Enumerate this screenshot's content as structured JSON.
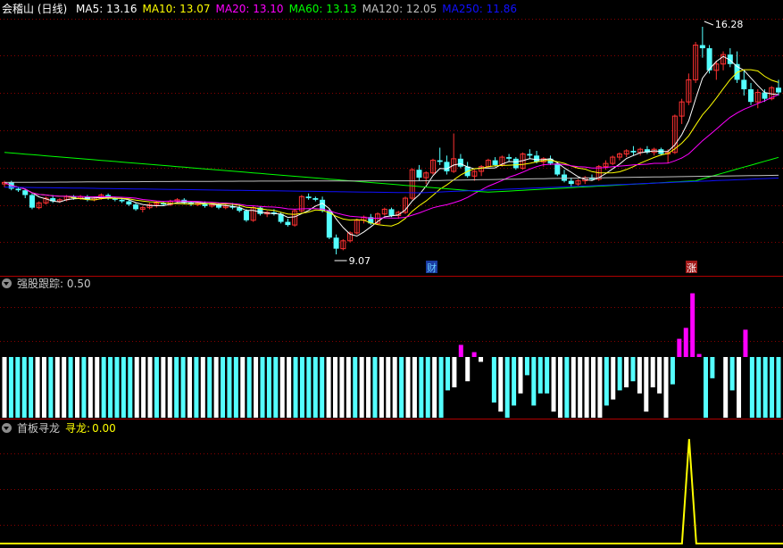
{
  "main_panel": {
    "stock_name": "会稽山",
    "period": "(日线)",
    "ma_items": [
      {
        "label": "MA5:",
        "value": "13.16",
        "color": "#ffffff"
      },
      {
        "label": "MA10:",
        "value": "13.07",
        "color": "#ffff00"
      },
      {
        "label": "MA20:",
        "value": "13.10",
        "color": "#ff00ff"
      },
      {
        "label": "MA60:",
        "value": "13.13",
        "color": "#00ff00"
      },
      {
        "label": "MA120:",
        "value": "12.05",
        "color": "#c0c0c0"
      },
      {
        "label": "MA250:",
        "value": "11.86",
        "color": "#1010ff"
      }
    ],
    "high_label": "16.28",
    "low_label": "9.07",
    "markers": [
      {
        "text": "财",
        "kind": "finance"
      },
      {
        "text": "涨",
        "kind": "limit-up"
      }
    ]
  },
  "indicator_1": {
    "name": "强股跟踪",
    "value_text": ": 0.50"
  },
  "indicator_2": {
    "name": "首板寻龙",
    "series_label": "寻龙:",
    "value": "0.00"
  },
  "colors": {
    "up": "#ff3232",
    "down": "#54ffff",
    "white_bar": "#ffffff",
    "magenta_bar": "#ff00ff",
    "grid": "#8b0000",
    "signal_line": "#ffff00"
  },
  "chart_data": [
    {
      "type": "candlestick",
      "title": "会稽山 (日线)",
      "price_range_shown": [
        9.07,
        16.28
      ],
      "ohlc": [
        [
          11.3,
          11.4,
          11.2,
          11.35
        ],
        [
          11.35,
          11.4,
          11.1,
          11.15
        ],
        [
          11.15,
          11.2,
          11.05,
          11.1
        ],
        [
          11.1,
          11.15,
          10.85,
          10.95
        ],
        [
          10.95,
          11.0,
          10.5,
          10.55
        ],
        [
          10.55,
          10.75,
          10.5,
          10.7
        ],
        [
          10.7,
          10.9,
          10.65,
          10.85
        ],
        [
          10.85,
          10.95,
          10.7,
          10.75
        ],
        [
          10.75,
          10.85,
          10.7,
          10.8
        ],
        [
          10.8,
          10.95,
          10.75,
          10.9
        ],
        [
          10.9,
          10.95,
          10.8,
          10.85
        ],
        [
          10.85,
          10.95,
          10.8,
          10.9
        ],
        [
          10.9,
          10.95,
          10.75,
          10.8
        ],
        [
          10.8,
          10.9,
          10.75,
          10.85
        ],
        [
          10.85,
          11.0,
          10.8,
          10.95
        ],
        [
          10.95,
          11.0,
          10.8,
          10.85
        ],
        [
          10.85,
          10.9,
          10.75,
          10.8
        ],
        [
          10.8,
          10.85,
          10.7,
          10.75
        ],
        [
          10.75,
          10.8,
          10.6,
          10.65
        ],
        [
          10.65,
          10.7,
          10.45,
          10.5
        ],
        [
          10.5,
          10.6,
          10.4,
          10.55
        ],
        [
          10.55,
          10.7,
          10.5,
          10.65
        ],
        [
          10.65,
          10.75,
          10.55,
          10.7
        ],
        [
          10.7,
          10.75,
          10.6,
          10.65
        ],
        [
          10.65,
          10.8,
          10.6,
          10.75
        ],
        [
          10.75,
          10.85,
          10.7,
          10.8
        ],
        [
          10.8,
          10.85,
          10.65,
          10.7
        ],
        [
          10.7,
          10.75,
          10.6,
          10.65
        ],
        [
          10.65,
          10.75,
          10.6,
          10.7
        ],
        [
          10.7,
          10.75,
          10.55,
          10.6
        ],
        [
          10.6,
          10.7,
          10.55,
          10.65
        ],
        [
          10.65,
          10.7,
          10.5,
          10.55
        ],
        [
          10.55,
          10.65,
          10.5,
          10.6
        ],
        [
          10.6,
          10.7,
          10.5,
          10.55
        ],
        [
          10.55,
          10.65,
          10.4,
          10.45
        ],
        [
          10.45,
          10.5,
          10.1,
          10.15
        ],
        [
          10.15,
          10.6,
          10.1,
          10.55
        ],
        [
          10.55,
          10.6,
          10.3,
          10.35
        ],
        [
          10.35,
          10.45,
          10.25,
          10.4
        ],
        [
          10.4,
          10.5,
          10.3,
          10.35
        ],
        [
          10.35,
          10.4,
          10.05,
          10.1
        ],
        [
          10.1,
          10.2,
          9.95,
          10.0
        ],
        [
          10.0,
          10.5,
          9.95,
          10.45
        ],
        [
          10.45,
          10.95,
          10.4,
          10.9
        ],
        [
          10.9,
          11.0,
          10.8,
          10.85
        ],
        [
          10.85,
          10.9,
          10.75,
          10.8
        ],
        [
          10.8,
          10.9,
          10.4,
          10.45
        ],
        [
          10.45,
          10.5,
          9.55,
          9.6
        ],
        [
          9.6,
          9.7,
          9.07,
          9.25
        ],
        [
          9.25,
          9.55,
          9.2,
          9.5
        ],
        [
          9.5,
          9.8,
          9.45,
          9.75
        ],
        [
          9.75,
          10.2,
          9.7,
          10.15
        ],
        [
          10.15,
          10.3,
          10.05,
          10.25
        ],
        [
          10.25,
          10.35,
          10.0,
          10.05
        ],
        [
          10.05,
          10.4,
          10.0,
          10.35
        ],
        [
          10.35,
          10.55,
          10.3,
          10.5
        ],
        [
          10.5,
          10.55,
          10.25,
          10.3
        ],
        [
          10.3,
          10.45,
          10.2,
          10.4
        ],
        [
          10.4,
          10.9,
          10.35,
          10.85
        ],
        [
          10.85,
          11.8,
          10.8,
          11.75
        ],
        [
          11.75,
          11.9,
          11.4,
          11.5
        ],
        [
          11.5,
          11.7,
          11.3,
          11.65
        ],
        [
          11.65,
          12.1,
          11.6,
          12.05
        ],
        [
          12.05,
          12.45,
          11.9,
          12.0
        ],
        [
          12.0,
          12.2,
          11.6,
          11.7
        ],
        [
          11.7,
          12.9,
          11.65,
          12.1
        ],
        [
          12.1,
          12.25,
          11.8,
          11.85
        ],
        [
          11.85,
          12.0,
          11.5,
          11.55
        ],
        [
          11.55,
          11.75,
          11.4,
          11.7
        ],
        [
          11.7,
          11.9,
          11.55,
          11.85
        ],
        [
          11.85,
          12.1,
          11.8,
          12.05
        ],
        [
          12.05,
          12.15,
          11.85,
          11.9
        ],
        [
          11.9,
          12.2,
          11.85,
          12.15
        ],
        [
          12.15,
          12.25,
          12.0,
          12.1
        ],
        [
          12.1,
          12.15,
          11.75,
          11.8
        ],
        [
          11.8,
          12.3,
          11.75,
          12.25
        ],
        [
          12.25,
          12.4,
          12.1,
          12.2
        ],
        [
          12.2,
          12.35,
          11.95,
          12.0
        ],
        [
          12.0,
          12.15,
          11.85,
          12.1
        ],
        [
          12.1,
          12.2,
          11.9,
          11.95
        ],
        [
          11.95,
          12.0,
          11.55,
          11.6
        ],
        [
          11.6,
          11.75,
          11.35,
          11.4
        ],
        [
          11.4,
          11.5,
          11.2,
          11.3
        ],
        [
          11.3,
          11.45,
          11.25,
          11.4
        ],
        [
          11.4,
          11.55,
          11.3,
          11.5
        ],
        [
          11.5,
          11.6,
          11.4,
          11.45
        ],
        [
          11.45,
          11.9,
          11.4,
          11.85
        ],
        [
          11.85,
          12.05,
          11.75,
          11.95
        ],
        [
          11.95,
          12.2,
          11.9,
          12.15
        ],
        [
          12.15,
          12.3,
          12.05,
          12.25
        ],
        [
          12.25,
          12.4,
          12.15,
          12.35
        ],
        [
          12.35,
          12.5,
          12.2,
          12.3
        ],
        [
          12.3,
          12.45,
          12.2,
          12.4
        ],
        [
          12.4,
          12.5,
          12.25,
          12.3
        ],
        [
          12.3,
          12.45,
          12.2,
          12.4
        ],
        [
          12.4,
          12.45,
          12.2,
          12.25
        ],
        [
          12.25,
          12.4,
          11.95,
          12.3
        ],
        [
          12.3,
          13.5,
          12.25,
          13.45
        ],
        [
          13.45,
          14.0,
          13.2,
          13.9
        ],
        [
          13.9,
          14.8,
          13.8,
          14.6
        ],
        [
          14.6,
          15.8,
          14.5,
          15.7
        ],
        [
          15.7,
          16.28,
          15.3,
          15.6
        ],
        [
          15.6,
          15.7,
          14.8,
          14.9
        ],
        [
          14.9,
          15.2,
          14.6,
          15.1
        ],
        [
          15.1,
          15.5,
          14.9,
          15.4
        ],
        [
          15.4,
          15.6,
          15.0,
          15.1
        ],
        [
          15.1,
          15.5,
          14.5,
          14.6
        ],
        [
          14.6,
          14.9,
          14.1,
          14.3
        ],
        [
          14.3,
          14.5,
          13.8,
          13.9
        ],
        [
          13.9,
          14.3,
          13.7,
          14.2
        ],
        [
          14.2,
          14.3,
          13.9,
          14.0
        ],
        [
          14.0,
          14.4,
          13.95,
          14.35
        ],
        [
          14.35,
          14.6,
          14.1,
          14.2
        ]
      ],
      "moving_averages": [
        "MA5",
        "MA10",
        "MA20",
        "MA60",
        "MA120",
        "MA250"
      ]
    },
    {
      "type": "bar",
      "title": "强股跟踪",
      "zero_line": 0,
      "values": [
        -1,
        -1,
        -1,
        -1,
        -1,
        -1,
        -1,
        -1,
        -1,
        -1,
        -1,
        -1,
        -1,
        -1,
        -1,
        -1,
        -1,
        -1,
        -1,
        -1,
        -1,
        -1,
        -1,
        -1,
        -1,
        -1,
        -1,
        -1,
        -1,
        -1,
        -1,
        -1,
        -1,
        -1,
        -1,
        -1,
        -1,
        -1,
        -1,
        -1,
        -1,
        -1,
        -1,
        -1,
        -1,
        -1,
        -1,
        -1,
        -1,
        -1,
        -1,
        -1,
        -1,
        -1,
        -1,
        -1,
        -1,
        -1,
        -1,
        -1,
        -1,
        -1,
        -1,
        -1,
        -1,
        -1,
        -1,
        -0.55,
        -0.5,
        0.2,
        -0.4,
        0.08,
        -0.08,
        0,
        -0.75,
        -0.9,
        -1,
        -0.8,
        -0.6,
        -0.3,
        -0.8,
        -0.6,
        -0.6,
        -0.9,
        -1,
        -1,
        -1,
        -1,
        -1,
        -1,
        -1,
        -0.8,
        -0.7,
        -0.55,
        -0.5,
        -0.4,
        -0.6,
        -0.9,
        -0.5,
        -0.6,
        -1,
        -0.45,
        0.3,
        0.48,
        1.05,
        0.05,
        -1,
        -0.35,
        0,
        -1,
        -0.55,
        -1,
        0.45,
        -1,
        -1,
        -1,
        -1,
        -1
      ],
      "colors_by_index": "cyan for negative down-days, white for negative up-days, magenta for positive"
    },
    {
      "type": "line",
      "title": "首板寻龙",
      "series": [
        {
          "name": "寻龙",
          "values_note": "0 everywhere except a single spike of 1 on the limit-up day",
          "spike_index": 101
        }
      ],
      "ylim": [
        0,
        1
      ]
    }
  ]
}
